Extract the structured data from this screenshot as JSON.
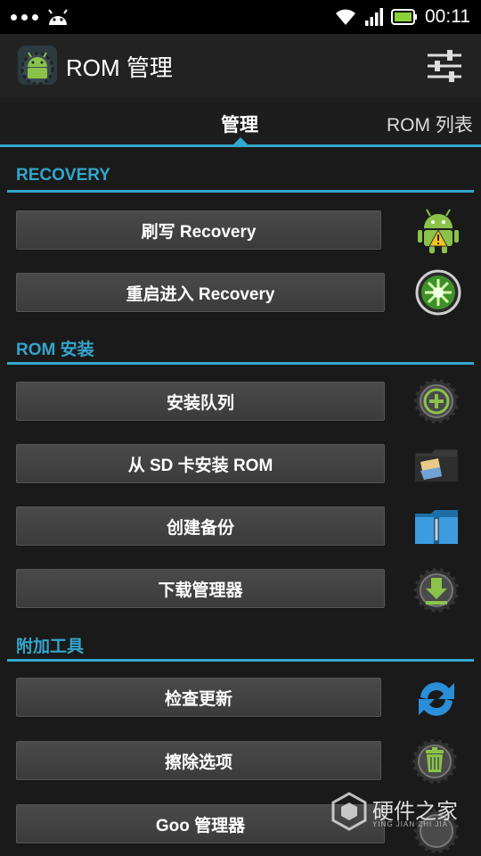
{
  "status_bar": {
    "time": "00:11",
    "icons": [
      "notification-dots",
      "android-icon",
      "wifi-icon",
      "signal-icon",
      "battery-icon"
    ]
  },
  "action_bar": {
    "title": "ROM 管理",
    "settings_icon": "sliders-icon"
  },
  "tabs": [
    {
      "label": "管理",
      "selected": true
    },
    {
      "label": "ROM 列表",
      "selected": false
    }
  ],
  "sections": {
    "recovery": {
      "title": "RECOVERY",
      "items": [
        {
          "label": "刷写 Recovery",
          "icon": "android-warning-icon"
        },
        {
          "label": "重启进入 Recovery",
          "icon": "reboot-flash-icon"
        }
      ]
    },
    "rom_install": {
      "title": "ROM 安装",
      "items": [
        {
          "label": "安装队列",
          "icon": "add-gear-icon"
        },
        {
          "label": "从 SD 卡安装 ROM",
          "icon": "sd-card-folder-icon"
        },
        {
          "label": "创建备份",
          "icon": "backup-folder-icon"
        },
        {
          "label": "下载管理器",
          "icon": "download-gear-icon"
        }
      ]
    },
    "extra_tools": {
      "title": "附加工具",
      "items": [
        {
          "label": "检查更新",
          "icon": "refresh-icon"
        },
        {
          "label": "擦除选项",
          "icon": "trash-gear-icon"
        },
        {
          "label": "Goo 管理器",
          "icon": "goo-gear-icon"
        }
      ]
    }
  },
  "watermark": {
    "text": "硬件之家",
    "sub": "YING JIAN ZHI JIA"
  },
  "colors": {
    "accent": "#33a6cc",
    "background": "#1a1a1a",
    "button": "#424242"
  }
}
